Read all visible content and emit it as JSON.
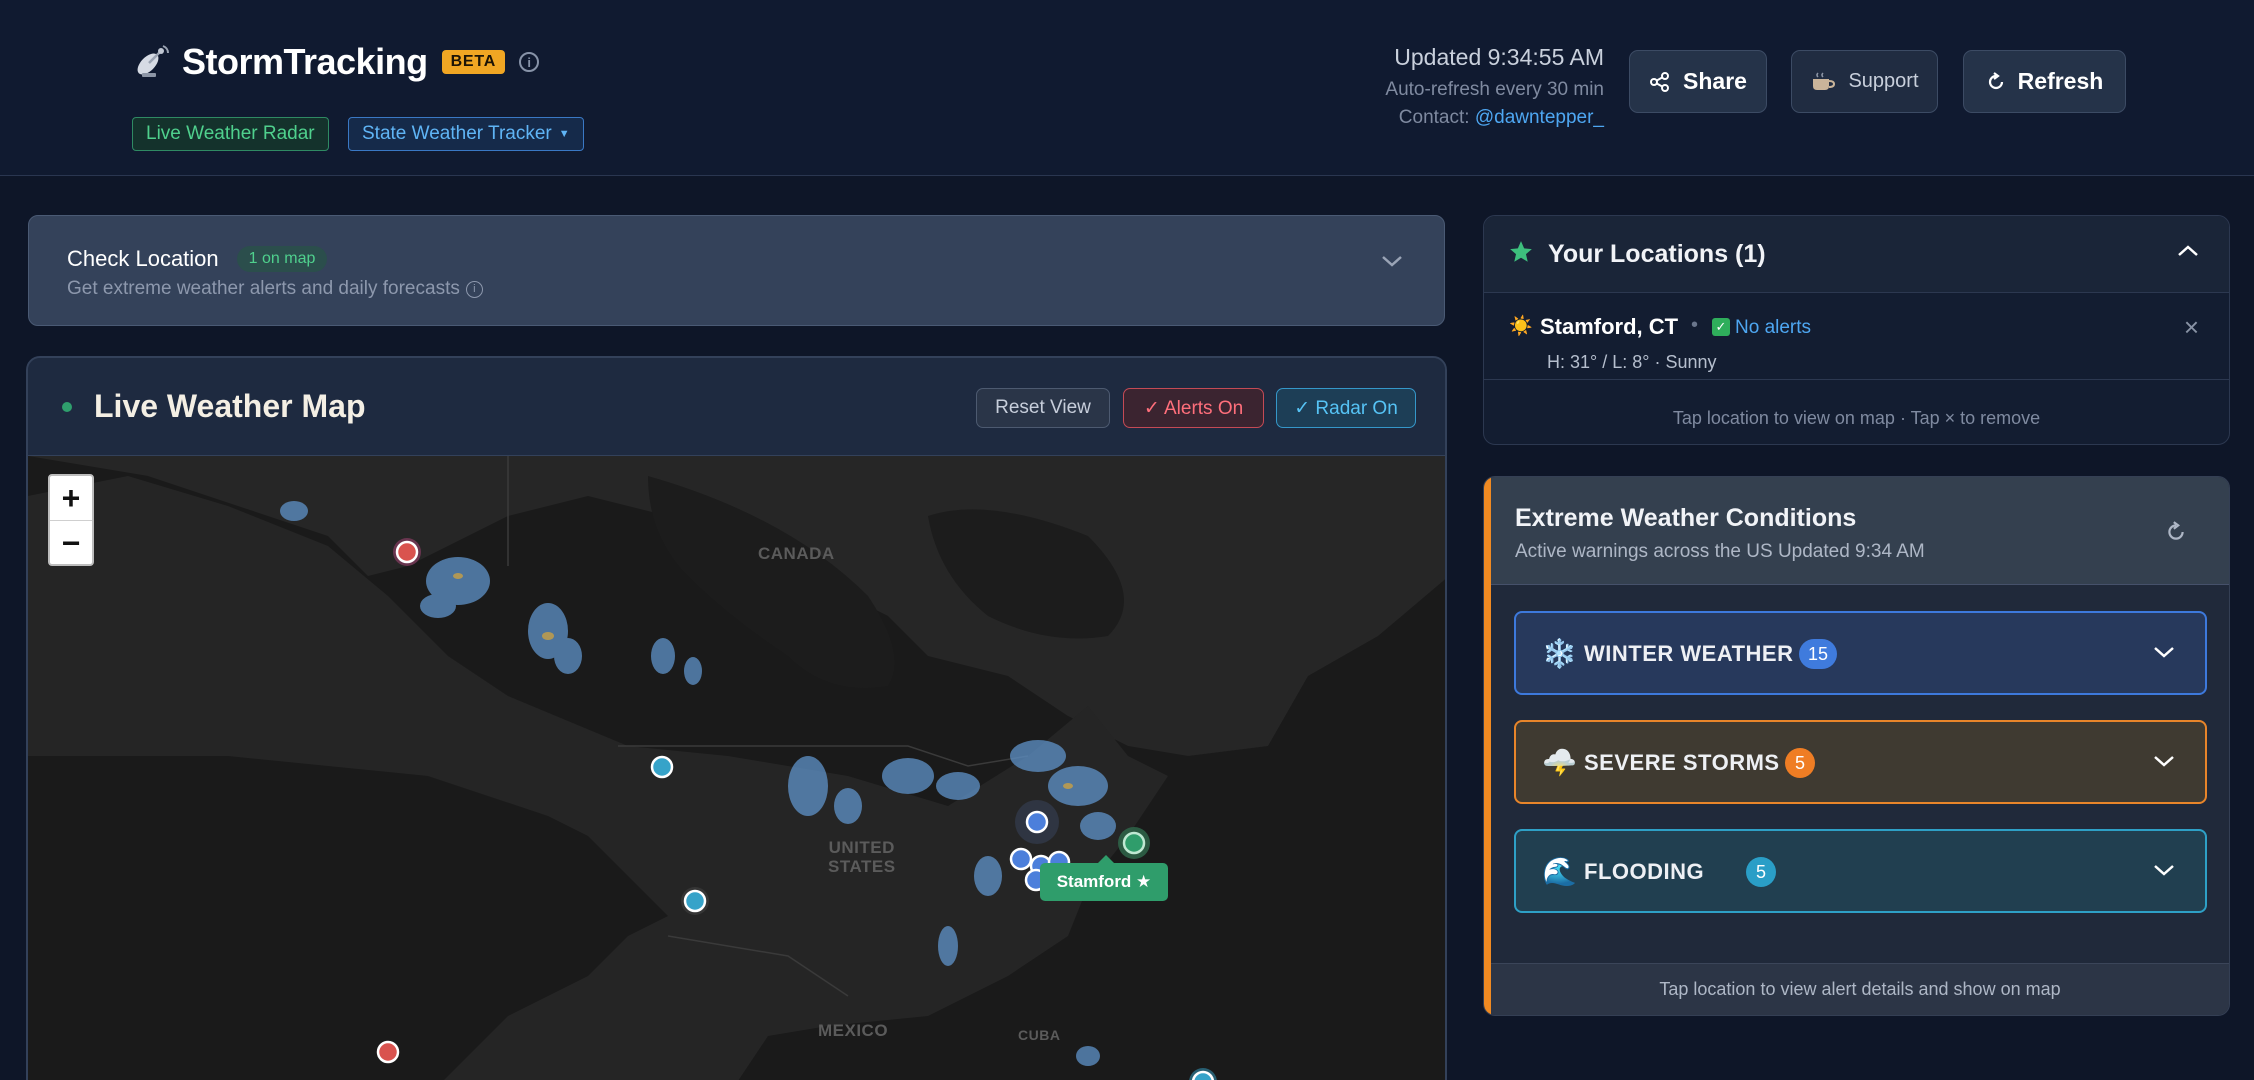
{
  "header": {
    "app_title": "StormTracking",
    "beta_badge": "BETA",
    "nav_pills": {
      "live_radar": "Live Weather Radar",
      "state_tracker": "State Weather Tracker"
    },
    "updated": "Updated 9:34:55 AM",
    "auto_refresh": "Auto-refresh every 30 min",
    "contact_label": "Contact:",
    "contact_handle": "@dawntepper_",
    "buttons": {
      "share": "Share",
      "support": "Support",
      "refresh": "Refresh"
    }
  },
  "check_location": {
    "title": "Check Location",
    "badge": "1 on map",
    "subtitle": "Get extreme weather alerts and daily forecasts"
  },
  "map_panel": {
    "title": "Live Weather Map",
    "reset_view": "Reset View",
    "alerts_toggle": "✓ Alerts On",
    "radar_toggle": "✓ Radar On",
    "zoom_in": "+",
    "zoom_out": "−",
    "labels": {
      "canada": "CANADA",
      "united_states": "UNITED\nSTATES",
      "mexico": "MEXICO",
      "cuba": "CUBA"
    },
    "stamford_tooltip": "Stamford ★"
  },
  "your_locations": {
    "title": "Your Locations (1)",
    "items": [
      {
        "city": "Stamford, CT",
        "status": "No alerts",
        "forecast": "H: 31° / L: 8° · Sunny"
      }
    ],
    "footer": "Tap location to view on map · Tap × to remove"
  },
  "extreme_weather": {
    "title": "Extreme Weather Conditions",
    "subtitle": "Active warnings across the US  Updated 9:34 AM",
    "categories": [
      {
        "label": "WINTER WEATHER",
        "count": "15",
        "icon": "snowflake-icon"
      },
      {
        "label": "SEVERE STORMS",
        "count": "5",
        "icon": "storm-cloud-icon"
      },
      {
        "label": "FLOODING",
        "count": "5",
        "icon": "wave-icon"
      }
    ],
    "footer": "Tap location to view alert details and show on map"
  },
  "colors": {
    "accent_orange": "#f08a22",
    "winter_blue": "#3d79dc",
    "flood_teal": "#2ea0c6",
    "success_green": "#2f9d6b"
  }
}
